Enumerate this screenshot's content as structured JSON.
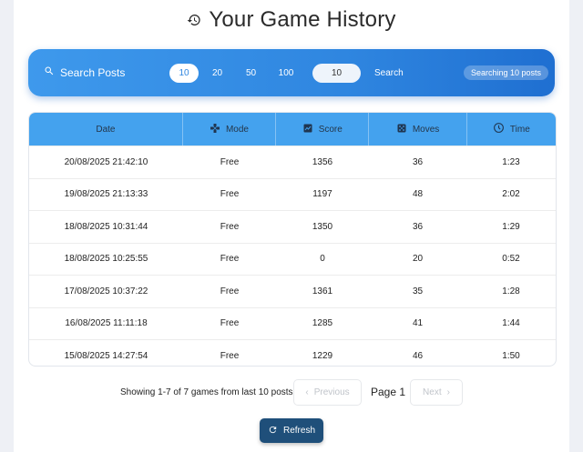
{
  "page": {
    "title": "Your Game History"
  },
  "search": {
    "label": "Search Posts",
    "counts": [
      "10",
      "20",
      "50",
      "100"
    ],
    "selected_count": "10",
    "input_value": "10",
    "button": "Search",
    "badge": "Searching 10 posts"
  },
  "table": {
    "headers": [
      "Date",
      "Mode",
      "Score",
      "Moves",
      "Time"
    ],
    "rows": [
      [
        "20/08/2025 21:42:10",
        "Free",
        "1356",
        "36",
        "1:23"
      ],
      [
        "19/08/2025 21:13:33",
        "Free",
        "1197",
        "48",
        "2:02"
      ],
      [
        "18/08/2025 10:31:44",
        "Free",
        "1350",
        "36",
        "1:29"
      ],
      [
        "18/08/2025 10:25:55",
        "Free",
        "0",
        "20",
        "0:52"
      ],
      [
        "17/08/2025 10:37:22",
        "Free",
        "1361",
        "35",
        "1:28"
      ],
      [
        "16/08/2025 11:11:18",
        "Free",
        "1285",
        "41",
        "1:44"
      ],
      [
        "15/08/2025 14:27:54",
        "Free",
        "1229",
        "46",
        "1:50"
      ]
    ]
  },
  "footer": {
    "info": "Showing 1-7 of 7 games from last 10 posts",
    "previous": "Previous",
    "page": "Page 1",
    "next": "Next",
    "refresh": "Refresh"
  },
  "colors": {
    "accent": "#2f86e0",
    "header": "#44a2ee",
    "refresh_bg": "#1f4f7a"
  },
  "icons": {
    "title": "history-icon",
    "search": "search-icon",
    "mode": "gamepad-icon",
    "score": "score-icon",
    "moves": "dice-icon",
    "time": "clock-icon",
    "refresh": "refresh-icon"
  }
}
